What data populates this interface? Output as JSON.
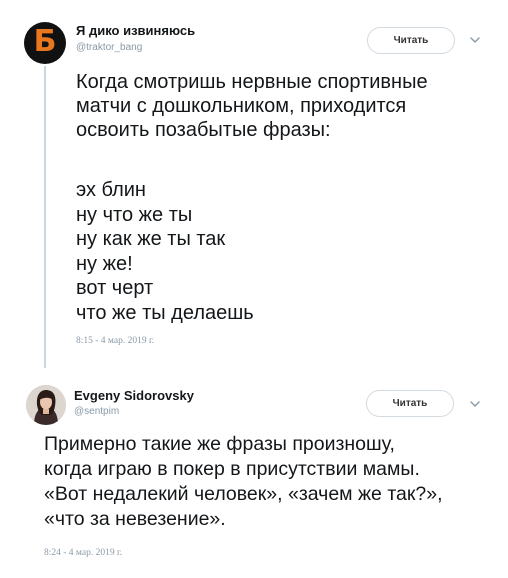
{
  "tweets": [
    {
      "author_name": "Я дико извиняюсь",
      "author_handle": "@traktor_bang",
      "avatar_letter": "Б",
      "follow_label": "Читать",
      "text_intro": [
        "Когда смотришь нервные спортивные",
        "матчи с дошкольником, приходится",
        "освоить позабытые фразы:"
      ],
      "text_phrases": [
        "эх блин",
        "ну что же ты",
        "ну как же ты так",
        "ну же!",
        "вот черт",
        "что же ты делаешь"
      ],
      "timestamp": "8:15 - 4 мар. 2019 г."
    },
    {
      "author_name": "Evgeny Sidorovsky",
      "author_handle": "@sentpim",
      "follow_label": "Читать",
      "text_lines": [
        "Примерно такие же фразы произношу,",
        "когда играю в покер в присутствии мамы.",
        "«Вот недалекий человек», «зачем же так?»,",
        "«что за невезение»."
      ],
      "timestamp": "8:24 - 4 мар. 2019 г."
    }
  ],
  "colors": {
    "text": "#14171a",
    "secondary": "#8899a6",
    "thread_line": "#ccd6dd",
    "avatar_bg": "#111111",
    "avatar_letter": "#e8761e"
  },
  "icons": {
    "menu": "chevron-down-icon"
  }
}
